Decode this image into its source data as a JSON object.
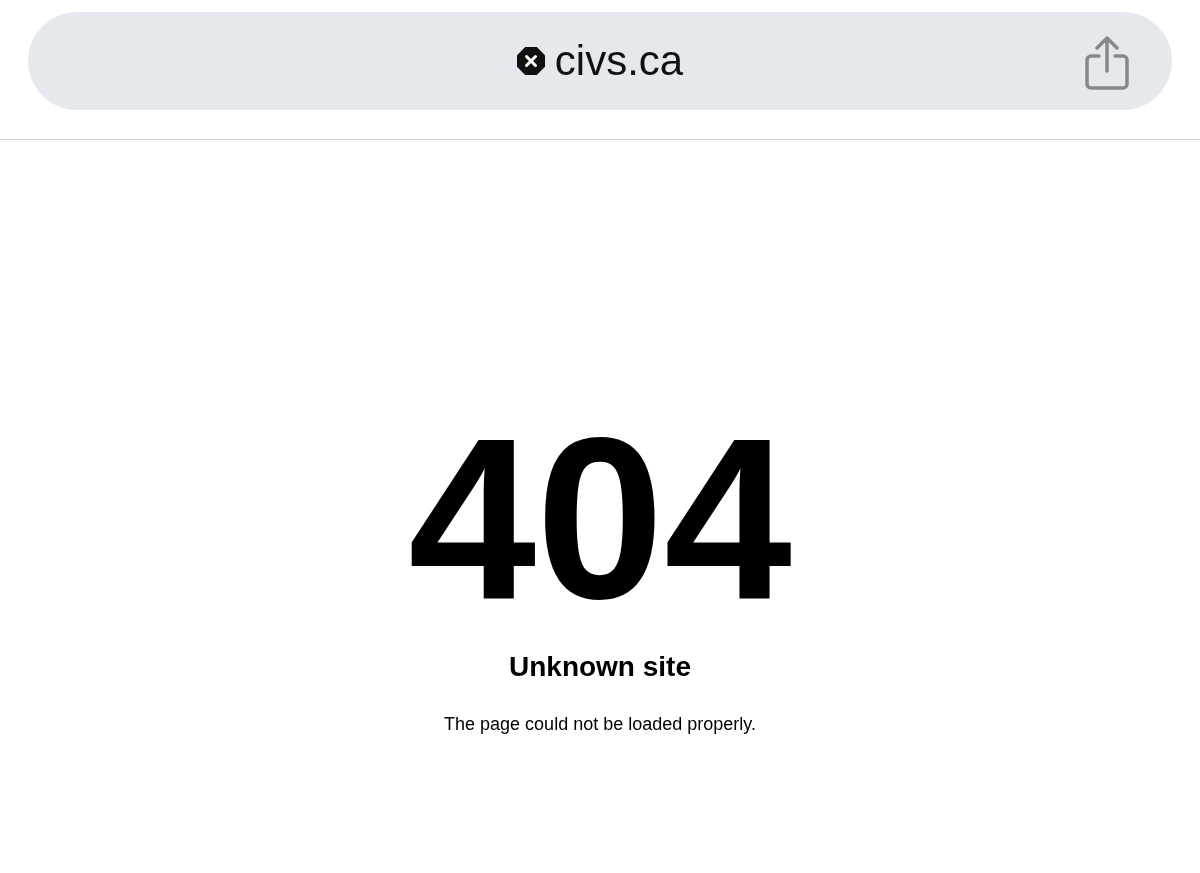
{
  "address_bar": {
    "url": "civs.ca"
  },
  "page": {
    "code": "404",
    "title": "Unknown site",
    "message": "The page could not be loaded properly."
  }
}
